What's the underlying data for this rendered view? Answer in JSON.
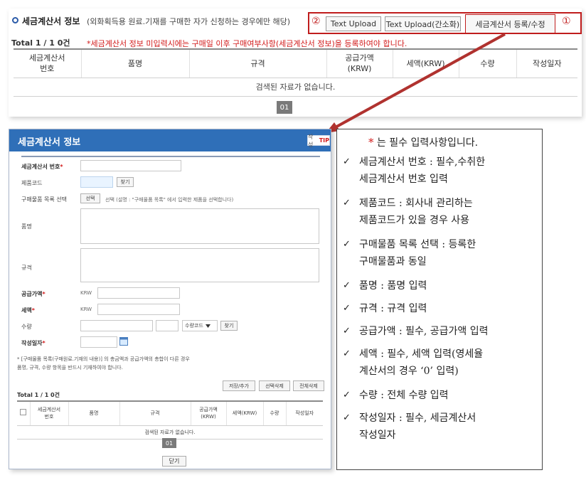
{
  "top": {
    "title": "세금계산서 정보",
    "note": "(외화획득용 원료.기재를 구매한 자가 신청하는 경우에만 해당)",
    "callouts": {
      "two": "②",
      "one": "①"
    },
    "buttons": {
      "text_upload": "Text Upload",
      "text_upload_simple": "Text Upload(간소화)",
      "register_edit": "세금계산서 등록/수정"
    },
    "total": "Total 1 / 1   0건",
    "warning": "*세금계산서 정보 미입력시에는 구매일 이후 구매여부사항(세금계산서 정보)을 등록하여야 합니다.",
    "table": {
      "headers": [
        "세금계산서\n번호",
        "품명",
        "규격",
        "공급가액\n(KRW)",
        "세액(KRW)",
        "수량",
        "작성일자"
      ],
      "empty": "검색된 자료가 없습니다."
    },
    "page": "01"
  },
  "dialog": {
    "title": "세금계산서 정보",
    "help_label": "작성",
    "help_tip": "TIP",
    "fields": {
      "invoice_no": "세금계산서 번호",
      "product_code": "제품코드",
      "find": "찾기",
      "purchase_select": "구매물품 목록 선택",
      "select_btn": "선택",
      "select_desc": "선택 (설명 : \"구매물품 목록\" 에서 입력한 제품을 선택합니다)",
      "item_name": "품명",
      "spec": "규격",
      "supply_amount": "공급가액",
      "tax_amount": "세액",
      "krw": "KRW",
      "quantity": "수량",
      "qty_unit": "수량코드",
      "write_date": "작성일자"
    },
    "notes": [
      "* [구매물품 목록(구매원료.기재의 내용)] 의 총금액과 공급가액의 총합이 다른 경우",
      "품명, 규격, 수량 항목을 반드시 기재하여야 합니다."
    ],
    "actions": {
      "save_add": "저장/추가",
      "delete_sel": "선택삭제",
      "delete_all": "전체삭제"
    },
    "total": "Total 1 / 1   0건",
    "table": {
      "headers": [
        "세금계산서\n번호",
        "품명",
        "규격",
        "공급가액\n(KRW)",
        "세액(KRW)",
        "수량",
        "작성일자"
      ],
      "empty": "검색된 자료가 없습니다."
    },
    "page": "01",
    "close": "닫기"
  },
  "desc": {
    "heading": "는 필수 입력사항입니다.",
    "items": [
      [
        "세금계산서 번호 : 필수,수취한",
        "세금계산서 번호 입력"
      ],
      [
        "제품코드 : 회사내 관리하는",
        "제품코드가 있을 경우 사용"
      ],
      [
        "구매물품 목록 선택 : 등록한",
        "구매물품과 동일"
      ],
      [
        "품명 : 품명 입력"
      ],
      [
        "규격 : 규격 입력"
      ],
      [
        "공급가액 : 필수, 공급가액 입력"
      ],
      [
        "세액 : 필수, 세액 입력(영세율",
        "계산서의 경우 ‘0’ 입력)"
      ],
      [
        "수량 : 전체 수량 입력"
      ],
      [
        "작성일자 : 필수, 세금계산서",
        "작성일자"
      ]
    ]
  },
  "colors": {
    "accent": "#2f6fb8",
    "callout_red": "#c01d1d",
    "warning_red": "#d21b1b",
    "arrow": "#b0322f"
  },
  "icons": [
    "circle-bullet-icon",
    "calendar-icon",
    "chevron-down-icon",
    "check-icon",
    "arrow-icon"
  ]
}
